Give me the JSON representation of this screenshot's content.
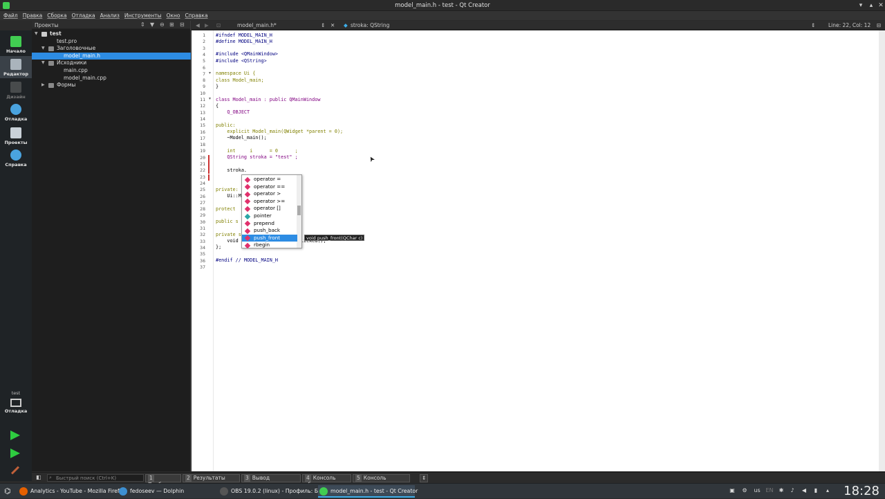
{
  "window": {
    "title": "model_main.h - test - Qt Creator"
  },
  "menu": [
    "Файл",
    "Правка",
    "Сборка",
    "Отладка",
    "Анализ",
    "Инструменты",
    "Окно",
    "Справка"
  ],
  "modes": [
    {
      "label": "Начало",
      "icon": "qt-logo-icon"
    },
    {
      "label": "Редактор",
      "icon": "editor-icon"
    },
    {
      "label": "Дизайн",
      "icon": "design-icon"
    },
    {
      "label": "Отладка",
      "icon": "debug-icon"
    },
    {
      "label": "Проекты",
      "icon": "projects-icon"
    },
    {
      "label": "Справка",
      "icon": "help-icon"
    }
  ],
  "kit": {
    "project": "test",
    "label": "Отладка"
  },
  "side_panel": {
    "title": "Проекты",
    "tree": [
      {
        "label": "test",
        "depth": 0,
        "expanded": true,
        "bold": true
      },
      {
        "label": "test.pro",
        "depth": 1
      },
      {
        "label": "Заголовочные",
        "depth": 1,
        "expanded": true
      },
      {
        "label": "model_main.h",
        "depth": 2,
        "selected": true
      },
      {
        "label": "Исходники",
        "depth": 1,
        "expanded": true
      },
      {
        "label": "main.cpp",
        "depth": 2
      },
      {
        "label": "model_main.cpp",
        "depth": 2
      },
      {
        "label": "Формы",
        "depth": 1,
        "expanded": false
      }
    ]
  },
  "editor_header": {
    "file": "model_main.h*",
    "symbol": "stroka: QString",
    "position": "Line: 22, Col: 12"
  },
  "code_lines": [
    "#ifndef MODEL_MAIN_H",
    "#define MODEL_MAIN_H",
    "",
    "#include <QMainWindow>",
    "#include <QString>",
    "",
    "namespace Ui {",
    "class Model_main;",
    "}",
    "",
    "class Model_main : public QMainWindow",
    "{",
    "    Q_OBJECT",
    "",
    "public:",
    "    explicit Model_main(QWidget *parent = 0);",
    "    ~Model_main();",
    "",
    "    int     i      = 0      ;",
    "    QString stroka = \"test\" ;",
    "",
    "    stroka.",
    "",
    "",
    "private:",
    "    Ui::M",
    "",
    "protect",
    "",
    "public s",
    "",
    "private s",
    "    void                    _clicked();",
    "};",
    "",
    "#endif // MODEL_MAIN_H",
    ""
  ],
  "completion": {
    "items": [
      {
        "label": "operator =",
        "color": "#e0306c"
      },
      {
        "label": "operator ==",
        "color": "#e0306c"
      },
      {
        "label": "operator >",
        "color": "#e0306c"
      },
      {
        "label": "operator >=",
        "color": "#e0306c"
      },
      {
        "label": "operator []",
        "color": "#e0306c"
      },
      {
        "label": "pointer",
        "color": "#2aa6a6"
      },
      {
        "label": "prepend",
        "color": "#e0306c"
      },
      {
        "label": "push_back",
        "color": "#e0306c"
      },
      {
        "label": "push_front",
        "color": "#e0306c",
        "selected": true
      },
      {
        "label": "rbegin",
        "color": "#e0306c"
      }
    ],
    "tooltip": "void push_front(QChar c)"
  },
  "bottom": {
    "search_placeholder": "Быстрый поиск (Ctrl+K)",
    "tabs": [
      {
        "n": "1",
        "label": "Проблемы"
      },
      {
        "n": "2",
        "label": "Результаты поиска"
      },
      {
        "n": "3",
        "label": "Вывод приложения"
      },
      {
        "n": "4",
        "label": "Консоль сборки"
      },
      {
        "n": "5",
        "label": "Консоль отладчика"
      }
    ]
  },
  "taskbar": {
    "tasks": [
      {
        "label": "Analytics - YouTube - Mozilla Firef...",
        "color": "#e66000"
      },
      {
        "label": "fedoseev — Dolphin",
        "color": "#3d8fd1"
      },
      {
        "label": "OBS 19.0.2 (linux) - Профиль: Бе...",
        "color": "#555"
      },
      {
        "label": "model_main.h - test - Qt Creator",
        "color": "#41cd52",
        "active": true
      }
    ],
    "layout": "us",
    "lang": "EN",
    "clock": "18:28"
  },
  "colors": {
    "accent": "#2d8ce3",
    "keyword": "#808000",
    "type": "#800080",
    "string": "#008000",
    "preprocessor": "#000080"
  }
}
